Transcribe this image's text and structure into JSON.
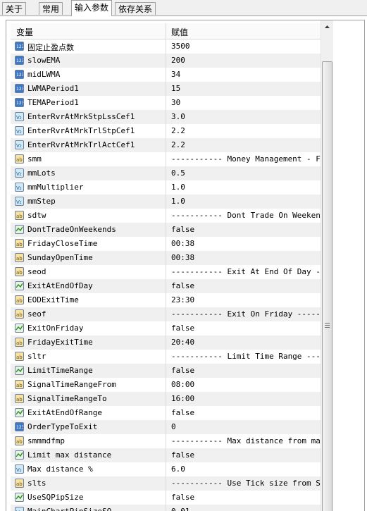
{
  "tabs": [
    "关于",
    "常用",
    "输入参数",
    "依存关系"
  ],
  "table": {
    "col_variable": "变量",
    "col_value": "赋值",
    "rows": [
      {
        "type": "int",
        "name": "固定止盈点数",
        "value": "3500"
      },
      {
        "type": "int",
        "name": "slowEMA",
        "value": "200"
      },
      {
        "type": "int",
        "name": "midLWMA",
        "value": "34"
      },
      {
        "type": "int",
        "name": "LWMAPeriod1",
        "value": "15"
      },
      {
        "type": "int",
        "name": "TEMAPeriod1",
        "value": "30"
      },
      {
        "type": "double",
        "name": "EnterRvrAtMrkStpLssCef1",
        "value": "3.0"
      },
      {
        "type": "double",
        "name": "EnterRvrAtMrkTrlStpCef1",
        "value": "2.2"
      },
      {
        "type": "double",
        "name": "EnterRvrAtMrkTrlActCef1",
        "value": "2.2"
      },
      {
        "type": "string",
        "name": "smm",
        "value": "----------- Money Management - F..."
      },
      {
        "type": "double",
        "name": "mmLots",
        "value": "0.5"
      },
      {
        "type": "double",
        "name": "mmMultiplier",
        "value": "1.0"
      },
      {
        "type": "double",
        "name": "mmStep",
        "value": "1.0"
      },
      {
        "type": "string",
        "name": "sdtw",
        "value": "----------- Dont Trade On Weeken..."
      },
      {
        "type": "bool",
        "name": "DontTradeOnWeekends",
        "value": "false"
      },
      {
        "type": "string",
        "name": "FridayCloseTime",
        "value": "00:38"
      },
      {
        "type": "string",
        "name": "SundayOpenTime",
        "value": "00:38"
      },
      {
        "type": "string",
        "name": "seod",
        "value": "----------- Exit At End Of Day -..."
      },
      {
        "type": "bool",
        "name": "ExitAtEndOfDay",
        "value": "false"
      },
      {
        "type": "string",
        "name": "EODExitTime",
        "value": "23:30"
      },
      {
        "type": "string",
        "name": "seof",
        "value": "----------- Exit On Friday -----..."
      },
      {
        "type": "bool",
        "name": "ExitOnFriday",
        "value": "false"
      },
      {
        "type": "string",
        "name": "FridayExitTime",
        "value": "20:40"
      },
      {
        "type": "string",
        "name": "sltr",
        "value": "----------- Limit Time Range ---..."
      },
      {
        "type": "bool",
        "name": "LimitTimeRange",
        "value": "false"
      },
      {
        "type": "string",
        "name": "SignalTimeRangeFrom",
        "value": "08:00"
      },
      {
        "type": "string",
        "name": "SignalTimeRangeTo",
        "value": "16:00"
      },
      {
        "type": "bool",
        "name": "ExitAtEndOfRange",
        "value": "false"
      },
      {
        "type": "int",
        "name": "OrderTypeToExit",
        "value": "0"
      },
      {
        "type": "string",
        "name": "smmmdfmp",
        "value": "----------- Max distance from ma..."
      },
      {
        "type": "bool",
        "name": "Limit max distance",
        "value": "false"
      },
      {
        "type": "double",
        "name": "Max distance %",
        "value": "6.0"
      },
      {
        "type": "string",
        "name": "slts",
        "value": "----------- Use Tick size from S..."
      },
      {
        "type": "bool",
        "name": "UseSQPipSize",
        "value": "false"
      },
      {
        "type": "double",
        "name": "MainChartPipSizeSQ",
        "value": "0.01"
      }
    ]
  }
}
